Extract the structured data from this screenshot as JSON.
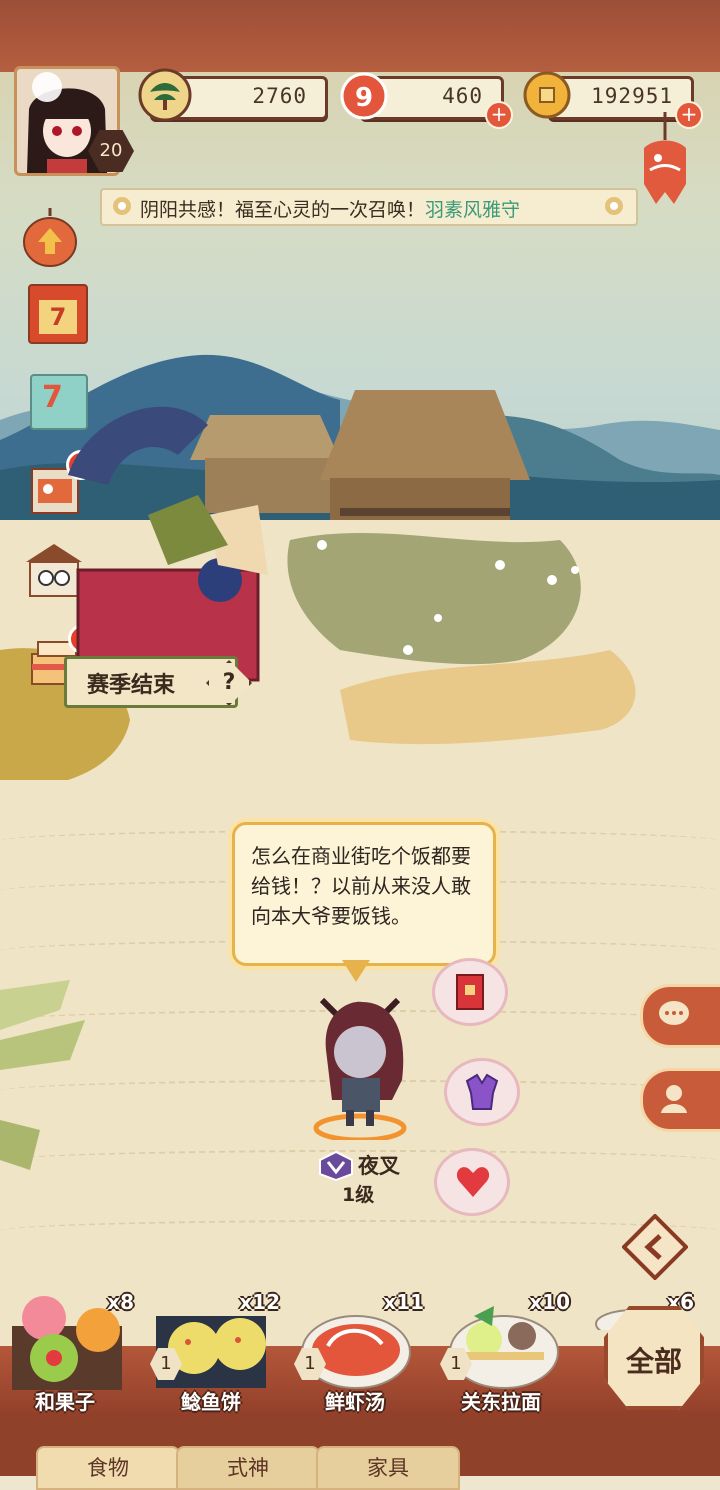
{
  "player": {
    "level": "20"
  },
  "resources": [
    {
      "name": "pine-currency",
      "icon": "pine-icon",
      "value": "2760"
    },
    {
      "name": "stamina",
      "icon": "fish-icon",
      "value": "460"
    },
    {
      "name": "coins",
      "icon": "coin-icon",
      "value": "192951"
    }
  ],
  "news": {
    "text": "阴阳共感！福至心灵的一次召唤！",
    "highlight": "羽素风雅守"
  },
  "season": {
    "label": "赛季结束",
    "help": "?"
  },
  "side_icons": [
    "upgrade-lantern-icon",
    "calendar-icon",
    "checkin-icon",
    "carp-flag-icon",
    "shop-icon",
    "cake-icon"
  ],
  "calendar_day": "7",
  "checkin_day": "7",
  "dialogue": {
    "text": "怎么在商业街吃个饭都要给钱！？以前从来没人敢向本大爷要饭钱。"
  },
  "character": {
    "name": "夜叉",
    "level": "1级"
  },
  "actions": [
    "red-envelope-icon",
    "kimono-icon",
    "heart-icon"
  ],
  "right_buttons": [
    "chat-icon",
    "onmyoji-icon",
    "collapse-icon"
  ],
  "foods": [
    {
      "name": "和果子",
      "count": "x8",
      "level": ""
    },
    {
      "name": "鲶鱼饼",
      "count": "x12",
      "level": "1"
    },
    {
      "name": "鲜虾汤",
      "count": "x11",
      "level": "1"
    },
    {
      "name": "关东拉面",
      "count": "x10",
      "level": "1"
    },
    {
      "name": "",
      "count": "x6",
      "level": ""
    }
  ],
  "all_button": "全部",
  "tabs": [
    "食物",
    "式神",
    "家具"
  ],
  "colors": {
    "accent": "#b55e40",
    "highlight": "#3b9b78",
    "bubble_border": "#e6b24c"
  }
}
